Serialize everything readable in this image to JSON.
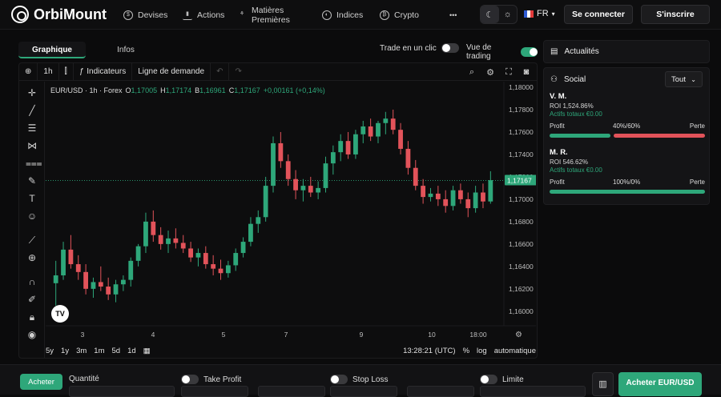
{
  "header": {
    "brand": "OrbiMount",
    "nav": [
      {
        "label": "Devises",
        "icon": "dollar-coin-icon"
      },
      {
        "label": "Actions",
        "icon": "bar-chart-icon"
      },
      {
        "label": "Matières Premières",
        "icon": "commodities-icon"
      },
      {
        "label": "Indices",
        "icon": "indices-icon"
      },
      {
        "label": "Crypto",
        "icon": "bitcoin-icon"
      }
    ],
    "more": "•••",
    "language": "FR",
    "login": "Se connecter",
    "signup": "S'inscrire"
  },
  "chart_panel": {
    "tabs": [
      "Graphique",
      "Infos"
    ],
    "active_tab": "Graphique",
    "one_click_label": "Trade en un clic",
    "one_click_on": false,
    "trading_view_label": "Vue de trading",
    "trading_view_on": true,
    "toolbar": {
      "interval": "1h",
      "indicators": "Indicateurs",
      "demand_line": "Ligne de demande"
    },
    "legend": {
      "symbol": "EUR/USD · 1h · Forex",
      "o_label": "O",
      "o": "1,17005",
      "h_label": "H",
      "h": "1,17174",
      "b_label": "B",
      "b": "1,16961",
      "c_label": "C",
      "c": "1,17167",
      "change": "+0,00161 (+0,14%)"
    },
    "tv_logo": "TV",
    "bottom": {
      "ranges": [
        "5y",
        "1y",
        "3m",
        "1m",
        "5d",
        "1d"
      ],
      "time": "13:28:21 (UTC)",
      "percent": "%",
      "log": "log",
      "auto": "automatique"
    }
  },
  "chart_data": {
    "type": "candlestick",
    "y_ticks": [
      "1,18000",
      "1,17800",
      "1,17600",
      "1,17400",
      "1,17200",
      "1,17000",
      "1,16800",
      "1,16600",
      "1,16400",
      "1,16200",
      "1,16000"
    ],
    "y_tick_values": [
      1.18,
      1.178,
      1.176,
      1.174,
      1.172,
      1.17,
      1.168,
      1.166,
      1.164,
      1.162,
      1.16
    ],
    "ylim": [
      1.1587,
      1.1805
    ],
    "x_ticks": [
      "3",
      "4",
      "5",
      "7",
      "9",
      "10",
      "18:00"
    ],
    "current_price_label": "1,17167",
    "current_price": 1.17167,
    "series": [
      {
        "open": 1.1625,
        "high": 1.1645,
        "low": 1.1605,
        "close": 1.1632
      },
      {
        "open": 1.1632,
        "high": 1.1662,
        "low": 1.1628,
        "close": 1.1655
      },
      {
        "open": 1.1655,
        "high": 1.1668,
        "low": 1.1638,
        "close": 1.1642
      },
      {
        "open": 1.1642,
        "high": 1.165,
        "low": 1.1628,
        "close": 1.1635
      },
      {
        "open": 1.1635,
        "high": 1.1642,
        "low": 1.1615,
        "close": 1.162
      },
      {
        "open": 1.162,
        "high": 1.163,
        "low": 1.1612,
        "close": 1.1626
      },
      {
        "open": 1.1626,
        "high": 1.164,
        "low": 1.1618,
        "close": 1.1622
      },
      {
        "open": 1.1622,
        "high": 1.163,
        "low": 1.161,
        "close": 1.1615
      },
      {
        "open": 1.1615,
        "high": 1.1628,
        "low": 1.1608,
        "close": 1.1624
      },
      {
        "open": 1.1624,
        "high": 1.1632,
        "low": 1.1618,
        "close": 1.1628
      },
      {
        "open": 1.1628,
        "high": 1.1648,
        "low": 1.1622,
        "close": 1.1645
      },
      {
        "open": 1.1645,
        "high": 1.166,
        "low": 1.164,
        "close": 1.1658
      },
      {
        "open": 1.1658,
        "high": 1.1688,
        "low": 1.1652,
        "close": 1.168
      },
      {
        "open": 1.168,
        "high": 1.169,
        "low": 1.1662,
        "close": 1.1668
      },
      {
        "open": 1.1668,
        "high": 1.1675,
        "low": 1.1655,
        "close": 1.166
      },
      {
        "open": 1.166,
        "high": 1.1672,
        "low": 1.1652,
        "close": 1.1665
      },
      {
        "open": 1.1665,
        "high": 1.1674,
        "low": 1.1656,
        "close": 1.1661
      },
      {
        "open": 1.1661,
        "high": 1.1668,
        "low": 1.1652,
        "close": 1.1656
      },
      {
        "open": 1.1656,
        "high": 1.1662,
        "low": 1.1644,
        "close": 1.1648
      },
      {
        "open": 1.1648,
        "high": 1.1656,
        "low": 1.164,
        "close": 1.1652
      },
      {
        "open": 1.1652,
        "high": 1.1658,
        "low": 1.1638,
        "close": 1.1642
      },
      {
        "open": 1.1642,
        "high": 1.165,
        "low": 1.1632,
        "close": 1.1638
      },
      {
        "open": 1.1638,
        "high": 1.1646,
        "low": 1.1628,
        "close": 1.1634
      },
      {
        "open": 1.1634,
        "high": 1.1645,
        "low": 1.163,
        "close": 1.1641
      },
      {
        "open": 1.1641,
        "high": 1.1656,
        "low": 1.1636,
        "close": 1.1652
      },
      {
        "open": 1.1652,
        "high": 1.1666,
        "low": 1.1648,
        "close": 1.1662
      },
      {
        "open": 1.1662,
        "high": 1.1684,
        "low": 1.1658,
        "close": 1.1678
      },
      {
        "open": 1.1678,
        "high": 1.169,
        "low": 1.167,
        "close": 1.1684
      },
      {
        "open": 1.1684,
        "high": 1.172,
        "low": 1.168,
        "close": 1.1712
      },
      {
        "open": 1.1712,
        "high": 1.1756,
        "low": 1.1706,
        "close": 1.175
      },
      {
        "open": 1.175,
        "high": 1.176,
        "low": 1.1728,
        "close": 1.1734
      },
      {
        "open": 1.1734,
        "high": 1.174,
        "low": 1.1712,
        "close": 1.1718
      },
      {
        "open": 1.1718,
        "high": 1.1726,
        "low": 1.17,
        "close": 1.1708
      },
      {
        "open": 1.1708,
        "high": 1.1718,
        "low": 1.1698,
        "close": 1.1712
      },
      {
        "open": 1.1712,
        "high": 1.172,
        "low": 1.1702,
        "close": 1.1706
      },
      {
        "open": 1.1706,
        "high": 1.1716,
        "low": 1.17,
        "close": 1.171
      },
      {
        "open": 1.171,
        "high": 1.1738,
        "low": 1.1706,
        "close": 1.1732
      },
      {
        "open": 1.1732,
        "high": 1.1748,
        "low": 1.1722,
        "close": 1.1742
      },
      {
        "open": 1.1742,
        "high": 1.1758,
        "low": 1.1734,
        "close": 1.1752
      },
      {
        "open": 1.1752,
        "high": 1.176,
        "low": 1.1736,
        "close": 1.174
      },
      {
        "open": 1.174,
        "high": 1.1762,
        "low": 1.1736,
        "close": 1.1758
      },
      {
        "open": 1.1758,
        "high": 1.177,
        "low": 1.175,
        "close": 1.1765
      },
      {
        "open": 1.1765,
        "high": 1.1772,
        "low": 1.1752,
        "close": 1.1756
      },
      {
        "open": 1.1756,
        "high": 1.177,
        "low": 1.175,
        "close": 1.1768
      },
      {
        "open": 1.1768,
        "high": 1.1778,
        "low": 1.1758,
        "close": 1.1772
      },
      {
        "open": 1.1772,
        "high": 1.178,
        "low": 1.1758,
        "close": 1.1762
      },
      {
        "open": 1.1762,
        "high": 1.1768,
        "low": 1.174,
        "close": 1.1745
      },
      {
        "open": 1.1745,
        "high": 1.1752,
        "low": 1.1722,
        "close": 1.1728
      },
      {
        "open": 1.1728,
        "high": 1.1735,
        "low": 1.1708,
        "close": 1.1712
      },
      {
        "open": 1.1712,
        "high": 1.1718,
        "low": 1.1696,
        "close": 1.1702
      },
      {
        "open": 1.1702,
        "high": 1.171,
        "low": 1.1698,
        "close": 1.1705
      },
      {
        "open": 1.1705,
        "high": 1.1712,
        "low": 1.1694,
        "close": 1.17
      },
      {
        "open": 1.17,
        "high": 1.1708,
        "low": 1.1688,
        "close": 1.1694
      },
      {
        "open": 1.1694,
        "high": 1.1712,
        "low": 1.169,
        "close": 1.1708
      },
      {
        "open": 1.1708,
        "high": 1.1714,
        "low": 1.1696,
        "close": 1.17
      },
      {
        "open": 1.17,
        "high": 1.1706,
        "low": 1.1684,
        "close": 1.1692
      },
      {
        "open": 1.1692,
        "high": 1.1712,
        "low": 1.1688,
        "close": 1.1706
      },
      {
        "open": 1.1706,
        "high": 1.1714,
        "low": 1.1692,
        "close": 1.1698
      },
      {
        "open": 1.1698,
        "high": 1.1725,
        "low": 1.1696,
        "close": 1.1717
      }
    ]
  },
  "right": {
    "news_label": "Actualités",
    "social_label": "Social",
    "filter": "Tout",
    "profit_label": "Profit",
    "loss_label": "Perte",
    "traders": [
      {
        "name": "V. M.",
        "roi": "ROI 1,524.86%",
        "assets": "Actifs totaux €0.00",
        "ratio": "40%/60%",
        "profit_pct": 40
      },
      {
        "name": "M. R.",
        "roi": "ROI 546.62%",
        "assets": "Actifs totaux €0.00",
        "ratio": "100%/0%",
        "profit_pct": 100
      }
    ]
  },
  "order": {
    "buy_tab": "Acheter",
    "quantity": "Quantité",
    "take_profit": "Take Profit",
    "stop_loss": "Stop Loss",
    "limit": "Limite",
    "buy_button": "Acheter EUR/USD"
  },
  "colors": {
    "up": "#2ea77a",
    "down": "#e2535a",
    "accent": "#2ea77a"
  }
}
